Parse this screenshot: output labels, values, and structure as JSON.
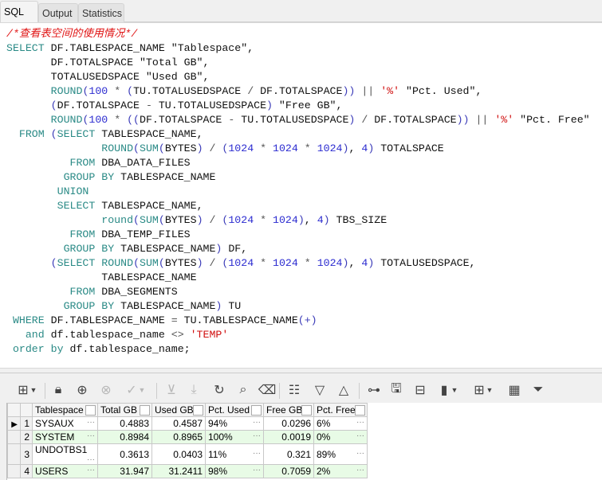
{
  "tabs": [
    {
      "label": "SQL",
      "active": true
    },
    {
      "label": "Output"
    },
    {
      "label": "Statistics"
    }
  ],
  "editor": {
    "lines": [
      [
        [
          "c",
          "/*查看表空间的使用情况*/"
        ]
      ],
      [
        [
          "k",
          "SELECT"
        ],
        [
          "t",
          " DF.TABLESPACE_NAME \"Tablespace\","
        ]
      ],
      [
        [
          "t",
          "       DF.TOTALSPACE \"Total GB\","
        ]
      ],
      [
        [
          "t",
          "       TOTALUSEDSPACE \"Used GB\","
        ]
      ],
      [
        [
          "t",
          "       "
        ],
        [
          "k",
          "ROUND"
        ],
        [
          "p",
          "("
        ],
        [
          "n",
          "100"
        ],
        [
          "o",
          " * "
        ],
        [
          "p",
          "("
        ],
        [
          "t",
          "TU.TOTALUSEDSPACE "
        ],
        [
          "o",
          "/"
        ],
        [
          "t",
          " DF.TOTALSPACE"
        ],
        [
          "p",
          "))"
        ],
        [
          "o",
          " || "
        ],
        [
          "s",
          "'%'"
        ],
        [
          "t",
          " \"Pct. Used\","
        ]
      ],
      [
        [
          "t",
          "       "
        ],
        [
          "p",
          "("
        ],
        [
          "t",
          "DF.TOTALSPACE "
        ],
        [
          "o",
          "-"
        ],
        [
          "t",
          " TU.TOTALUSEDSPACE"
        ],
        [
          "p",
          ")"
        ],
        [
          "t",
          " \"Free GB\","
        ]
      ],
      [
        [
          "t",
          "       "
        ],
        [
          "k",
          "ROUND"
        ],
        [
          "p",
          "("
        ],
        [
          "n",
          "100"
        ],
        [
          "o",
          " * "
        ],
        [
          "p",
          "(("
        ],
        [
          "t",
          "DF.TOTALSPACE "
        ],
        [
          "o",
          "-"
        ],
        [
          "t",
          " TU.TOTALUSEDSPACE"
        ],
        [
          "p",
          ")"
        ],
        [
          "o",
          " / "
        ],
        [
          "t",
          "DF.TOTALSPACE"
        ],
        [
          "p",
          "))"
        ],
        [
          "o",
          " || "
        ],
        [
          "s",
          "'%'"
        ],
        [
          "t",
          " \"Pct. Free\""
        ]
      ],
      [
        [
          "t",
          "  "
        ],
        [
          "k",
          "FROM"
        ],
        [
          "t",
          " "
        ],
        [
          "p",
          "("
        ],
        [
          "k",
          "SELECT"
        ],
        [
          "t",
          " TABLESPACE_NAME,"
        ]
      ],
      [
        [
          "t",
          "               "
        ],
        [
          "k",
          "ROUND"
        ],
        [
          "p",
          "("
        ],
        [
          "k",
          "SUM"
        ],
        [
          "p",
          "("
        ],
        [
          "t",
          "BYTES"
        ],
        [
          "p",
          ")"
        ],
        [
          "o",
          " / "
        ],
        [
          "p",
          "("
        ],
        [
          "n",
          "1024"
        ],
        [
          "o",
          " * "
        ],
        [
          "n",
          "1024"
        ],
        [
          "o",
          " * "
        ],
        [
          "n",
          "1024"
        ],
        [
          "p",
          ")"
        ],
        [
          "t",
          ", "
        ],
        [
          "n",
          "4"
        ],
        [
          "p",
          ")"
        ],
        [
          "t",
          " TOTALSPACE"
        ]
      ],
      [
        [
          "t",
          "          "
        ],
        [
          "k",
          "FROM"
        ],
        [
          "t",
          " DBA_DATA_FILES"
        ]
      ],
      [
        [
          "t",
          "         "
        ],
        [
          "k",
          "GROUP BY"
        ],
        [
          "t",
          " TABLESPACE_NAME"
        ]
      ],
      [
        [
          "t",
          "        "
        ],
        [
          "k",
          "UNION"
        ]
      ],
      [
        [
          "t",
          "        "
        ],
        [
          "k",
          "SELECT"
        ],
        [
          "t",
          " TABLESPACE_NAME,"
        ]
      ],
      [
        [
          "t",
          "               "
        ],
        [
          "k",
          "round"
        ],
        [
          "p",
          "("
        ],
        [
          "k",
          "SUM"
        ],
        [
          "p",
          "("
        ],
        [
          "t",
          "BYTES"
        ],
        [
          "p",
          ")"
        ],
        [
          "o",
          " / "
        ],
        [
          "p",
          "("
        ],
        [
          "n",
          "1024"
        ],
        [
          "o",
          " * "
        ],
        [
          "n",
          "1024"
        ],
        [
          "p",
          ")"
        ],
        [
          "t",
          ", "
        ],
        [
          "n",
          "4"
        ],
        [
          "p",
          ")"
        ],
        [
          "t",
          " TBS_SIZE"
        ]
      ],
      [
        [
          "t",
          "          "
        ],
        [
          "k",
          "FROM"
        ],
        [
          "t",
          " DBA_TEMP_FILES"
        ]
      ],
      [
        [
          "t",
          "         "
        ],
        [
          "k",
          "GROUP BY"
        ],
        [
          "t",
          " TABLESPACE_NAME"
        ],
        [
          "p",
          ")"
        ],
        [
          "t",
          " DF,"
        ]
      ],
      [
        [
          "t",
          "       "
        ],
        [
          "p",
          "("
        ],
        [
          "k",
          "SELECT"
        ],
        [
          "t",
          " "
        ],
        [
          "k",
          "ROUND"
        ],
        [
          "p",
          "("
        ],
        [
          "k",
          "SUM"
        ],
        [
          "p",
          "("
        ],
        [
          "t",
          "BYTES"
        ],
        [
          "p",
          ")"
        ],
        [
          "o",
          " / "
        ],
        [
          "p",
          "("
        ],
        [
          "n",
          "1024"
        ],
        [
          "o",
          " * "
        ],
        [
          "n",
          "1024"
        ],
        [
          "o",
          " * "
        ],
        [
          "n",
          "1024"
        ],
        [
          "p",
          ")"
        ],
        [
          "t",
          ", "
        ],
        [
          "n",
          "4"
        ],
        [
          "p",
          ")"
        ],
        [
          "t",
          " TOTALUSEDSPACE,"
        ]
      ],
      [
        [
          "t",
          "               TABLESPACE_NAME"
        ]
      ],
      [
        [
          "t",
          "          "
        ],
        [
          "k",
          "FROM"
        ],
        [
          "t",
          " DBA_SEGMENTS"
        ]
      ],
      [
        [
          "t",
          "         "
        ],
        [
          "k",
          "GROUP BY"
        ],
        [
          "t",
          " TABLESPACE_NAME"
        ],
        [
          "p",
          ")"
        ],
        [
          "t",
          " TU"
        ]
      ],
      [
        [
          "t",
          " "
        ],
        [
          "k",
          "WHERE"
        ],
        [
          "t",
          " DF.TABLESPACE_NAME "
        ],
        [
          "o",
          "="
        ],
        [
          "t",
          " TU.TABLESPACE_NAME"
        ],
        [
          "p",
          "(+)"
        ]
      ],
      [
        [
          "t",
          "   "
        ],
        [
          "k",
          "and"
        ],
        [
          "t",
          " df.tablespace_name "
        ],
        [
          "o",
          "<>"
        ],
        [
          "t",
          " "
        ],
        [
          "s",
          "'TEMP'"
        ]
      ],
      [
        [
          "t",
          " "
        ],
        [
          "k",
          "order by"
        ],
        [
          "t",
          " df.tablespace_name;"
        ]
      ]
    ]
  },
  "toolbar": [
    {
      "icon": "grid-options-icon",
      "dropdown": true
    },
    {
      "icon": "lock-icon"
    },
    {
      "icon": "add-record-icon"
    },
    {
      "icon": "delete-record-icon",
      "disabled": true
    },
    {
      "icon": "commit-check-icon",
      "disabled": true,
      "dropdown": true
    },
    {
      "icon": "fetch-next-icon",
      "disabled": true
    },
    {
      "icon": "fetch-all-icon",
      "disabled": true
    },
    {
      "icon": "refresh-icon"
    },
    {
      "icon": "find-icon"
    },
    {
      "icon": "clear-icon"
    },
    {
      "icon": "single-record-icon"
    },
    {
      "icon": "next-record-icon"
    },
    {
      "icon": "previous-record-icon"
    },
    {
      "icon": "tree-view-icon"
    },
    {
      "icon": "export-icon"
    },
    {
      "icon": "import-icon"
    },
    {
      "icon": "chart-icon",
      "dropdown": true
    },
    {
      "icon": "layout-icon",
      "dropdown": true
    },
    {
      "icon": "table-view-icon"
    },
    {
      "icon": "filter-icon"
    }
  ],
  "grid": {
    "columns": [
      "Tablespace",
      "Total GB",
      "Used GB",
      "Pct. Used",
      "Free GB",
      "Pct. Free"
    ],
    "rows": [
      {
        "n": "1",
        "tablespace": "SYSAUX",
        "total": "0.4883",
        "used": "0.4587",
        "pct_used": "94%",
        "free": "0.0296",
        "pct_free": "6%"
      },
      {
        "n": "2",
        "tablespace": "SYSTEM",
        "total": "0.8984",
        "used": "0.8965",
        "pct_used": "100%",
        "free": "0.0019",
        "pct_free": "0%"
      },
      {
        "n": "3",
        "tablespace": "UNDOTBS1",
        "total": "0.3613",
        "used": "0.0403",
        "pct_used": "11%",
        "free": "0.321",
        "pct_free": "89%"
      },
      {
        "n": "4",
        "tablespace": "USERS",
        "total": "31.947",
        "used": "31.2411",
        "pct_used": "98%",
        "free": "0.7059",
        "pct_free": "2%"
      }
    ],
    "ellipsis": "···",
    "current_marker": "▶"
  }
}
